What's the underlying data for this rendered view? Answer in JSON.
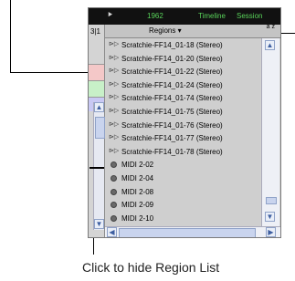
{
  "topbar": {
    "pointer_icon": "cursor-arrow-icon",
    "counter": "1962",
    "timeline_label": "Timeline",
    "session_label": "Session"
  },
  "tracks": {
    "label": "3|1"
  },
  "region_list": {
    "header": "Regions",
    "sort_label": "a z",
    "items": [
      {
        "type": "audio",
        "name": "Scratchie-FF14_01-18 (Stereo)"
      },
      {
        "type": "audio",
        "name": "Scratchie-FF14_01-20 (Stereo)"
      },
      {
        "type": "audio",
        "name": "Scratchie-FF14_01-22 (Stereo)"
      },
      {
        "type": "audio",
        "name": "Scratchie-FF14_01-24 (Stereo)"
      },
      {
        "type": "audio",
        "name": "Scratchie-FF14_01-74 (Stereo)"
      },
      {
        "type": "audio",
        "name": "Scratchie-FF14_01-75 (Stereo)"
      },
      {
        "type": "audio",
        "name": "Scratchie-FF14_01-76 (Stereo)"
      },
      {
        "type": "audio",
        "name": "Scratchie-FF14_01-77 (Stereo)"
      },
      {
        "type": "audio",
        "name": "Scratchie-FF14_01-78 (Stereo)"
      },
      {
        "type": "midi",
        "name": "MIDI 2-02"
      },
      {
        "type": "midi",
        "name": "MIDI 2-04"
      },
      {
        "type": "midi",
        "name": "MIDI 2-08"
      },
      {
        "type": "midi",
        "name": "MIDI 2-09"
      },
      {
        "type": "midi",
        "name": "MIDI 2-10"
      }
    ]
  },
  "buttons": {
    "hide_region_list": "»",
    "nav_right": ">"
  },
  "caption": "Click to hide Region List",
  "colors": {
    "counter_green": "#59d35a",
    "lane_red": "#f4c8c8",
    "lane_green": "#c8f0c8",
    "lane_blue": "#c8c8f4"
  }
}
